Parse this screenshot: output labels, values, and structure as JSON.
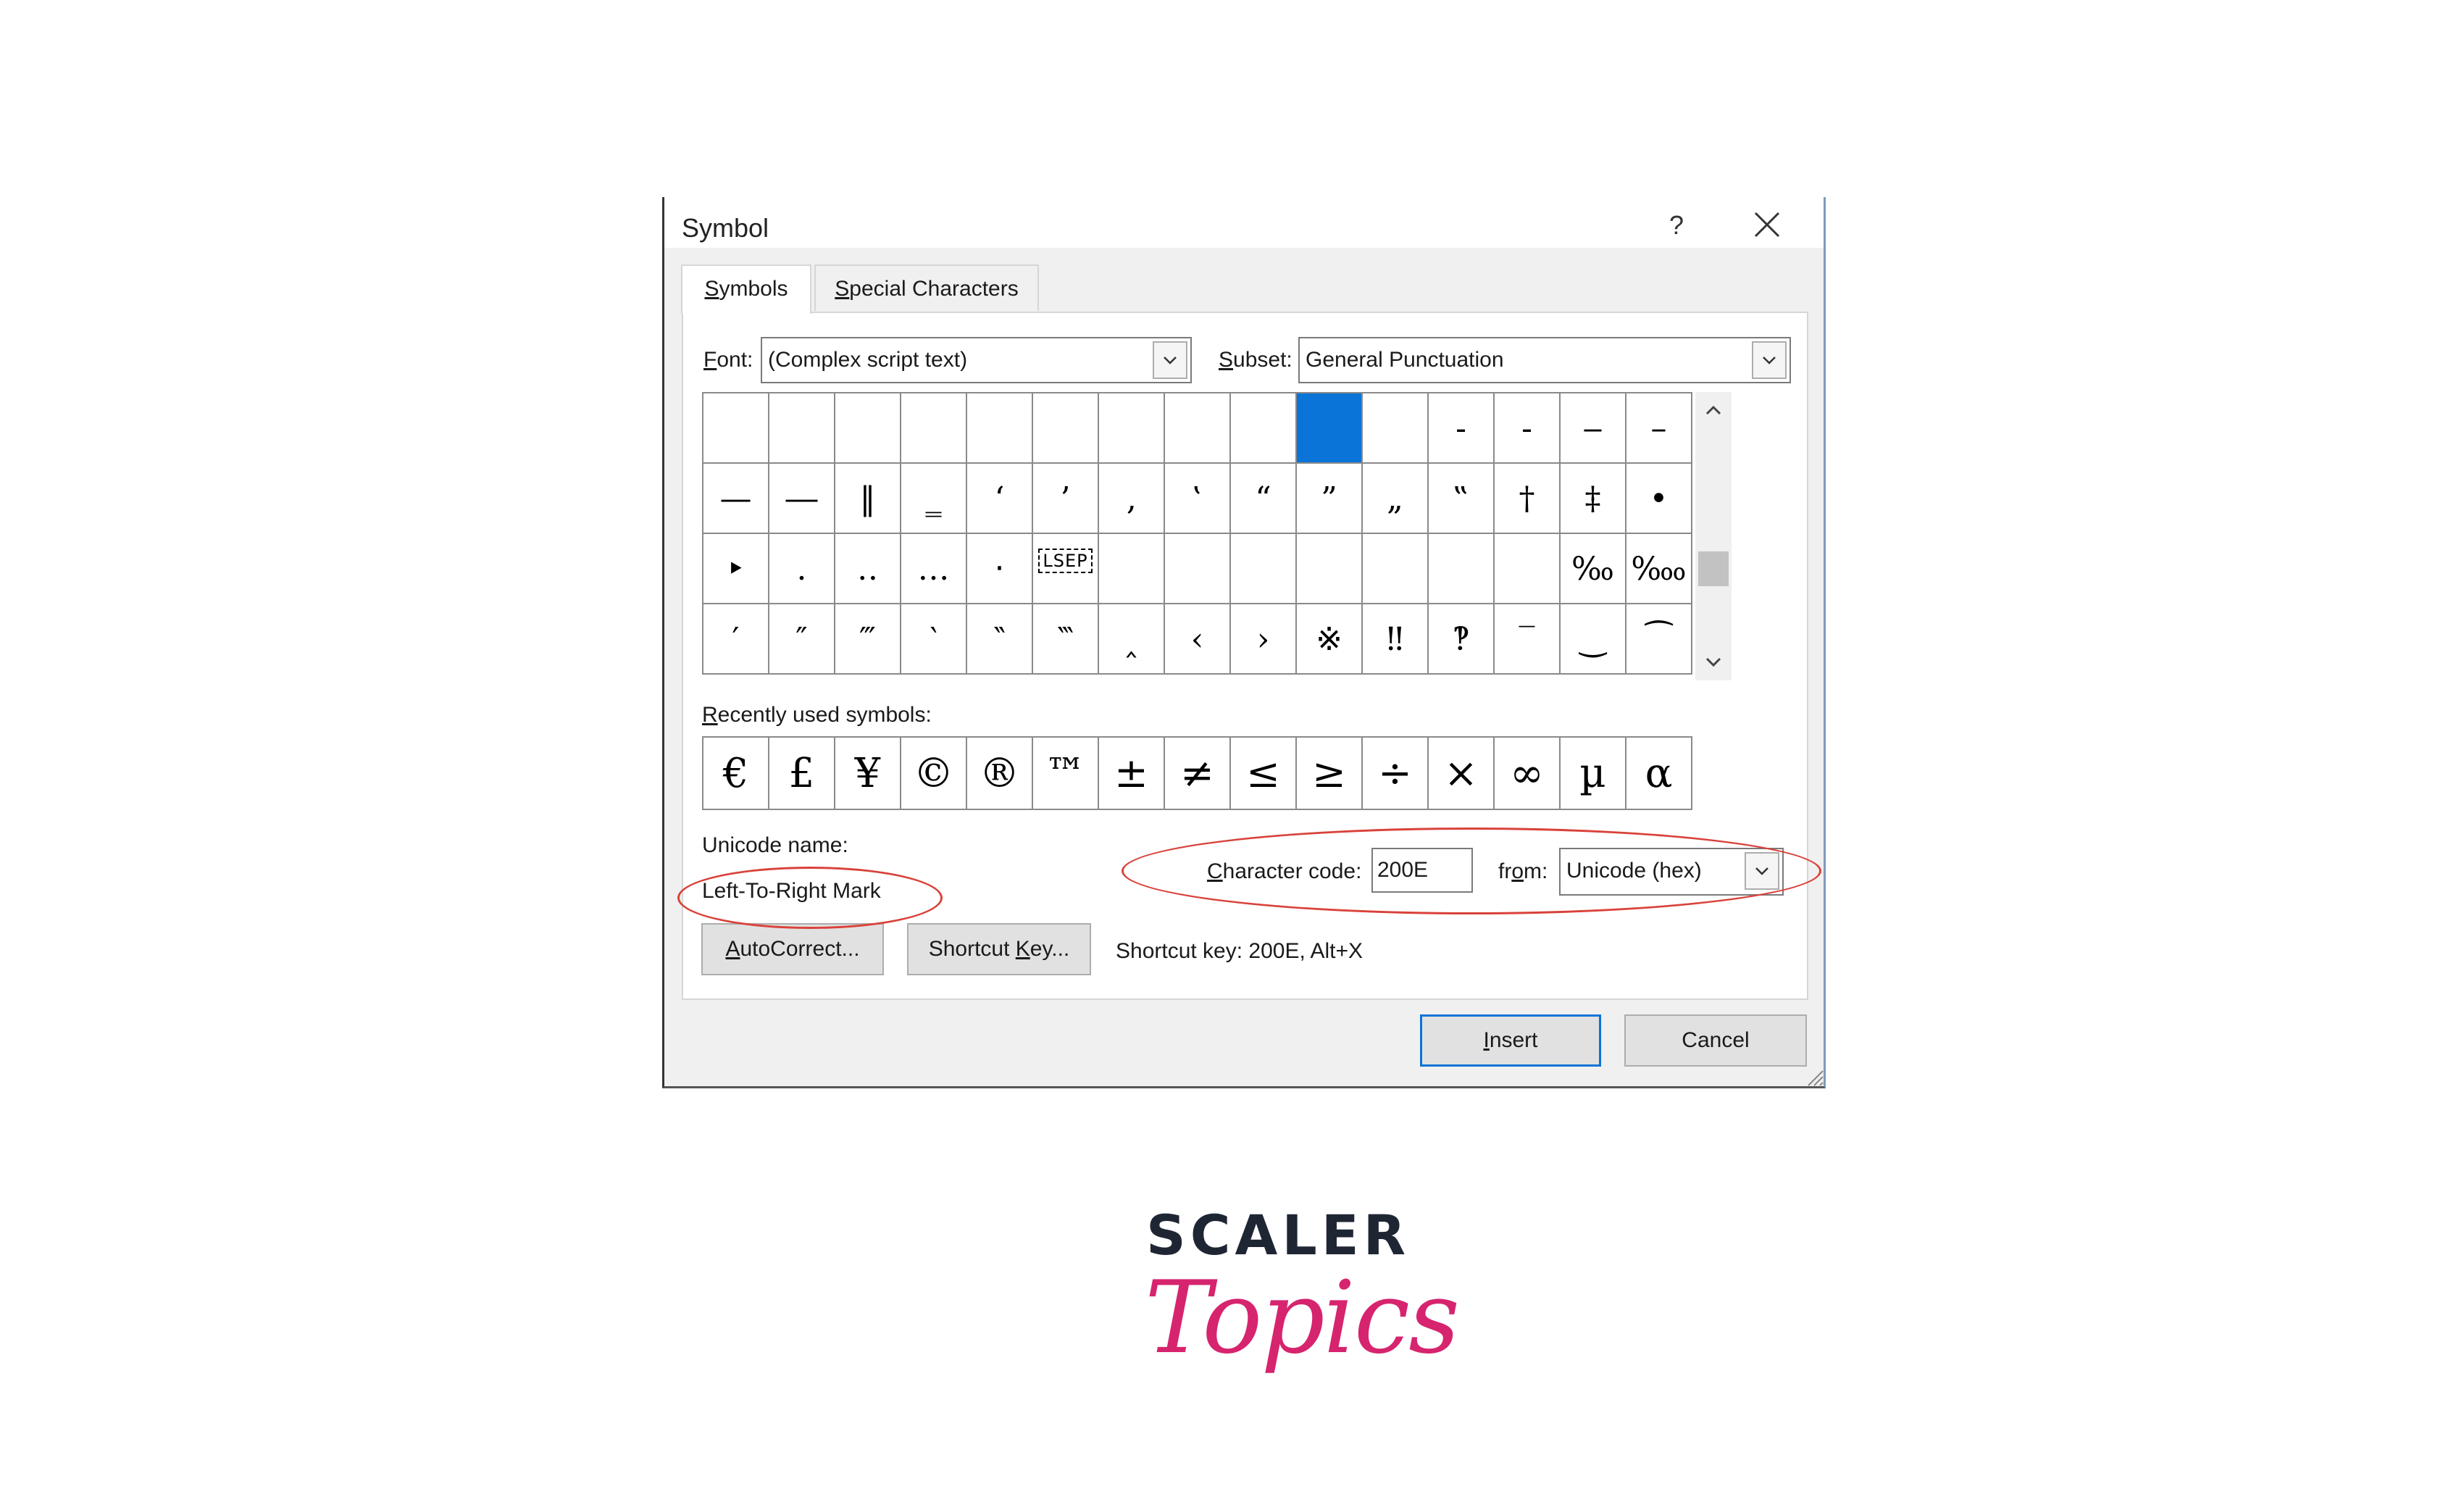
{
  "dialog": {
    "title": "Symbol",
    "help": "?",
    "tabs": {
      "symbols": {
        "pre": "",
        "key": "S",
        "post": "ymbols"
      },
      "special": {
        "pre": "",
        "key": "S",
        "post": "pecial Characters"
      }
    },
    "font": {
      "label_key": "F",
      "label_rest": "ont:",
      "value": "(Complex script text)"
    },
    "subset": {
      "label_key": "S",
      "label_rest": "ubset:",
      "value": "General Punctuation"
    },
    "symbol_grid": [
      [
        "",
        "",
        "",
        "",
        "",
        "",
        "",
        "",
        "",
        "",
        "",
        "‐",
        "‑",
        "‒",
        "–"
      ],
      [
        "—",
        "―",
        "‖",
        "‗",
        "‘",
        "’",
        "‚",
        "‛",
        "“",
        "”",
        "„",
        "‟",
        "†",
        "‡",
        "•"
      ],
      [
        "‣",
        "․",
        "‥",
        "…",
        "‧",
        "LSEP",
        "",
        "",
        "",
        "",
        "",
        "",
        "",
        "‰",
        "‱"
      ],
      [
        "′",
        "″",
        "‴",
        "‵",
        "‶",
        "‷",
        "‸",
        "‹",
        "›",
        "※",
        "‼",
        "‽",
        "‾",
        "‿",
        "⁀"
      ]
    ],
    "selected_cell": {
      "row": 0,
      "col": 9
    },
    "recent_label_key": "R",
    "recent_label_rest": "ecently used symbols:",
    "recent_symbols": [
      "€",
      "£",
      "¥",
      "©",
      "®",
      "™",
      "±",
      "≠",
      "≤",
      "≥",
      "÷",
      "×",
      "∞",
      "µ",
      "α"
    ],
    "unicode_name_label": "Unicode name:",
    "unicode_name_value": "Left-To-Right Mark",
    "char_code": {
      "label_key": "C",
      "label_rest": "haracter code:",
      "value": "200E"
    },
    "from": {
      "label_pre": "fr",
      "label_key": "o",
      "label_rest": "m:",
      "value": "Unicode (hex)"
    },
    "buttons": {
      "autocorrect": {
        "key": "A",
        "rest": "utoCorrect..."
      },
      "shortcut_key": {
        "pre": "Shortcut ",
        "key": "K",
        "rest": "ey..."
      },
      "insert": {
        "key": "I",
        "rest": "nsert"
      },
      "cancel": "Cancel"
    },
    "shortcut_info": "Shortcut key: 200E, Alt+X"
  },
  "logo": {
    "line1": "SCALER",
    "line2": "Topics"
  },
  "colors": {
    "selection": "#0a74d8",
    "annotation": "#d9423a",
    "logo_pink": "#d6246e",
    "logo_dark": "#1f2633"
  }
}
